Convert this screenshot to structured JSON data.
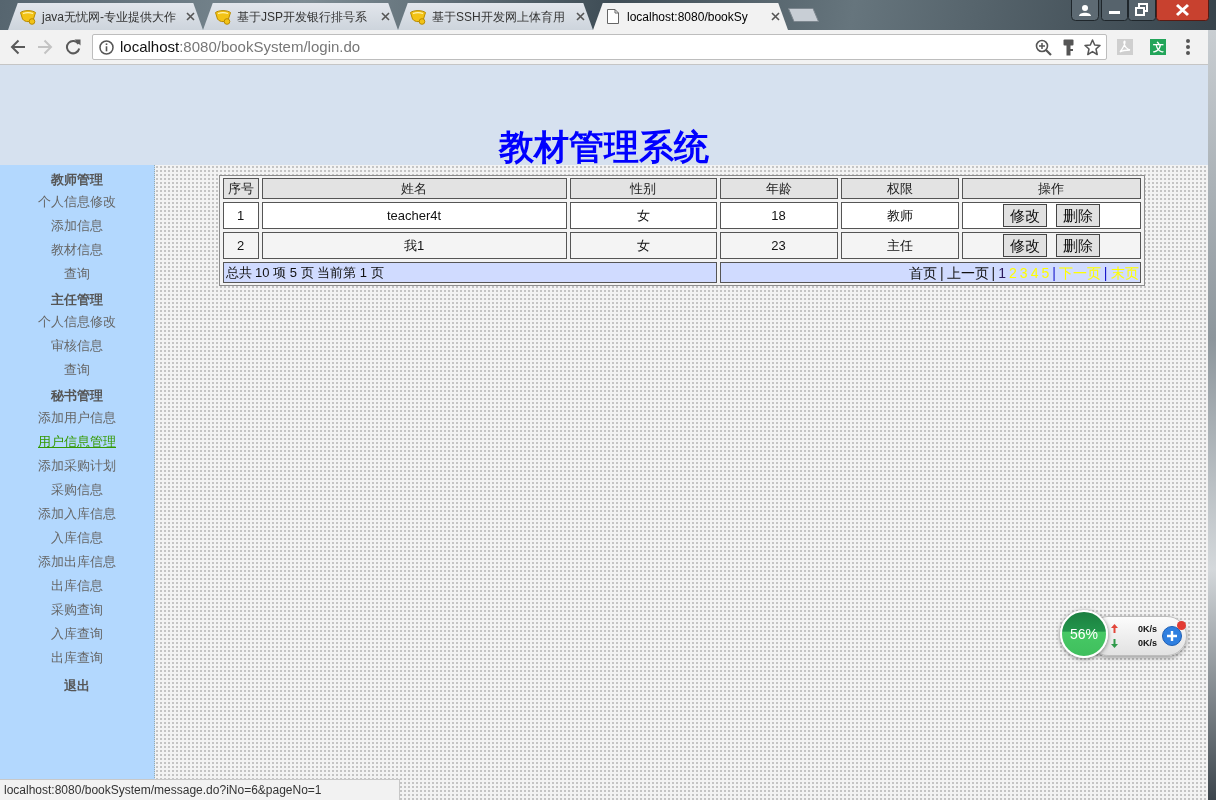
{
  "browser": {
    "tabs": [
      {
        "title": "java无忧网-专业提供大作",
        "kind": "site",
        "selected": false
      },
      {
        "title": "基于JSP开发银行排号系",
        "kind": "site",
        "selected": false
      },
      {
        "title": "基于SSH开发网上体育用",
        "kind": "site",
        "selected": false
      },
      {
        "title": "localhost:8080/bookSy",
        "kind": "page",
        "selected": true
      }
    ],
    "toolbar": {
      "back_disabled": false,
      "forward_disabled": true,
      "address_host": "localhost",
      "address_path": ":8080/bookSystem/login.do",
      "translate_label": "文"
    }
  },
  "page": {
    "title": "教材管理系统"
  },
  "sidebar": {
    "sections": [
      {
        "heading": "教师管理",
        "items": [
          {
            "label": "个人信息修改",
            "selected": false
          },
          {
            "label": "添加信息",
            "selected": false
          },
          {
            "label": "教材信息",
            "selected": false
          },
          {
            "label": "查询",
            "selected": false
          }
        ]
      },
      {
        "heading": "主任管理",
        "items": [
          {
            "label": "个人信息修改",
            "selected": false
          },
          {
            "label": "审核信息",
            "selected": false
          },
          {
            "label": "查询",
            "selected": false
          }
        ]
      },
      {
        "heading": "秘书管理",
        "items": [
          {
            "label": "添加用户信息",
            "selected": false
          },
          {
            "label": "用户信息管理",
            "selected": true
          },
          {
            "label": "添加采购计划",
            "selected": false
          },
          {
            "label": "采购信息",
            "selected": false
          },
          {
            "label": "添加入库信息",
            "selected": false
          },
          {
            "label": "入库信息",
            "selected": false
          },
          {
            "label": "添加出库信息",
            "selected": false
          },
          {
            "label": "出库信息",
            "selected": false
          },
          {
            "label": "采购查询",
            "selected": false
          },
          {
            "label": "入库查询",
            "selected": false
          },
          {
            "label": "出库查询",
            "selected": false
          }
        ]
      }
    ],
    "logout": "退出"
  },
  "table": {
    "columns": [
      "序号",
      "姓名",
      "性别",
      "年龄",
      "权限",
      "操作"
    ],
    "rows": [
      {
        "cells": [
          "1",
          "teacher4t",
          "女",
          "18",
          "教师"
        ],
        "actions": [
          "修改",
          "删除"
        ]
      },
      {
        "cells": [
          "2",
          "我1",
          "女",
          "23",
          "主任"
        ],
        "actions": [
          "修改",
          "删除"
        ]
      }
    ],
    "summary": "总共 10 项 5 页 当前第 1 页",
    "pager": [
      {
        "label": "首页",
        "kind": "text"
      },
      {
        "label": "|",
        "kind": "separator"
      },
      {
        "label": "上一页",
        "kind": "text"
      },
      {
        "label": "|",
        "kind": "separator"
      },
      {
        "label": "1",
        "kind": "current"
      },
      {
        "label": "2",
        "kind": "link"
      },
      {
        "label": "3",
        "kind": "link"
      },
      {
        "label": "4",
        "kind": "link"
      },
      {
        "label": "5",
        "kind": "link"
      },
      {
        "label": "|",
        "kind": "link_separator"
      },
      {
        "label": "下一页",
        "kind": "link"
      },
      {
        "label": "|",
        "kind": "link_separator"
      },
      {
        "label": "末页",
        "kind": "link"
      }
    ]
  },
  "speed_widget": {
    "percent": "56%",
    "upload": "0K/s",
    "download": "0K/s"
  },
  "status_bar": {
    "url": "localhost:8080/bookSystem/message.do?iNo=6&pageNo=1"
  }
}
